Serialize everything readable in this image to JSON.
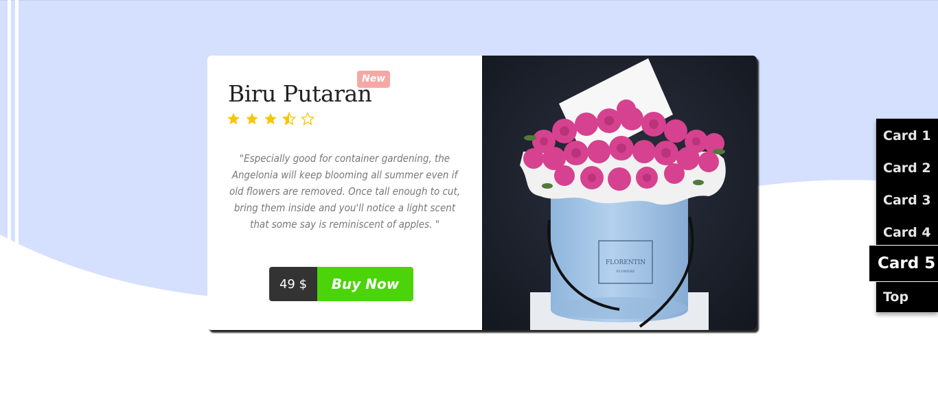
{
  "card": {
    "title": "Biru Putaran",
    "badge": "New",
    "rating": 3.5,
    "rating_max": 5,
    "quote": "\"Especially good for container gardening, the Angelonia will keep blooming all summer even if old flowers are removed. Once tall enough to cut, bring them inside and you'll notice a light scent that some say is reminiscent of apples. \"",
    "price": "49 $",
    "buy_label": "Buy Now",
    "box_label": "FLORENTIN",
    "box_sublabel": "FLOWERS"
  },
  "nav": {
    "items": [
      "Card 1",
      "Card 2",
      "Card 3",
      "Card 4",
      "Card 5",
      "Top"
    ],
    "active": "Card 5"
  },
  "colors": {
    "background_wave": "#d5e0fe",
    "badge": "#f6a7a4",
    "buy_button": "#4cd40a",
    "price_bg": "#333333",
    "star": "#f6c603"
  },
  "icons": [
    "star-full-icon",
    "star-half-icon",
    "star-empty-icon"
  ]
}
